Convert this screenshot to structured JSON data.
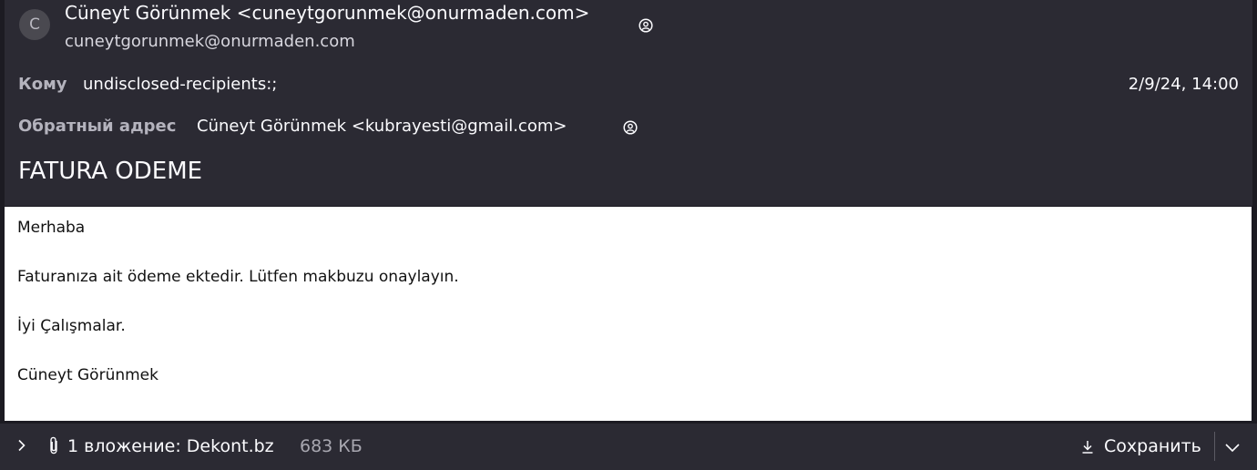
{
  "header": {
    "avatar_letter": "C",
    "from_line": "Cüneyt Görünmek <cuneytgorunmek@onurmaden.com>",
    "from_email": "cuneytgorunmek@onurmaden.com",
    "to_label": "Кому",
    "to_value": "undisclosed-recipients:;",
    "date": "2/9/24, 14:00",
    "reply_to_label": "Обратный адрес",
    "reply_to_value": "Cüneyt Görünmek <kubrayesti@gmail.com>",
    "subject": "FATURA ODEME",
    "contact_icon": "contact-icon"
  },
  "body": {
    "lines": [
      "Merhaba",
      "Faturanıza ait ödeme ektedir. Lütfen makbuzu onaylayın.",
      "İyi Çalışmalar.",
      "Cüneyt Görünmek"
    ]
  },
  "attachments": {
    "summary": "1 вложение: Dekont.bz",
    "size": "683 КБ",
    "save_label": "Сохранить",
    "icons": [
      "chevron-right-icon",
      "paperclip-icon",
      "download-icon",
      "chevron-down-icon"
    ]
  },
  "colors": {
    "header_bg": "#2b2a33",
    "frame_bg": "#1c1b22",
    "body_bg": "#ffffff"
  }
}
